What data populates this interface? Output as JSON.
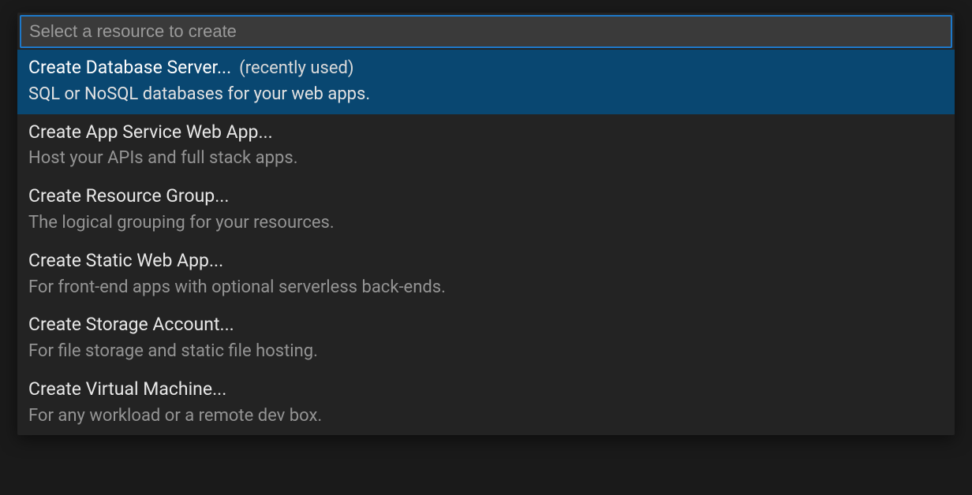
{
  "search": {
    "placeholder": "Select a resource to create",
    "value": ""
  },
  "options": [
    {
      "title": "Create Database Server...",
      "badge": "(recently used)",
      "description": "SQL or NoSQL databases for your web apps.",
      "selected": true
    },
    {
      "title": "Create App Service Web App...",
      "badge": "",
      "description": "Host your APIs and full stack apps.",
      "selected": false
    },
    {
      "title": "Create Resource Group...",
      "badge": "",
      "description": "The logical grouping for your resources.",
      "selected": false
    },
    {
      "title": "Create Static Web App...",
      "badge": "",
      "description": "For front-end apps with optional serverless back-ends.",
      "selected": false
    },
    {
      "title": "Create Storage Account...",
      "badge": "",
      "description": "For file storage and static file hosting.",
      "selected": false
    },
    {
      "title": "Create Virtual Machine...",
      "badge": "",
      "description": "For any workload or a remote dev box.",
      "selected": false
    }
  ]
}
